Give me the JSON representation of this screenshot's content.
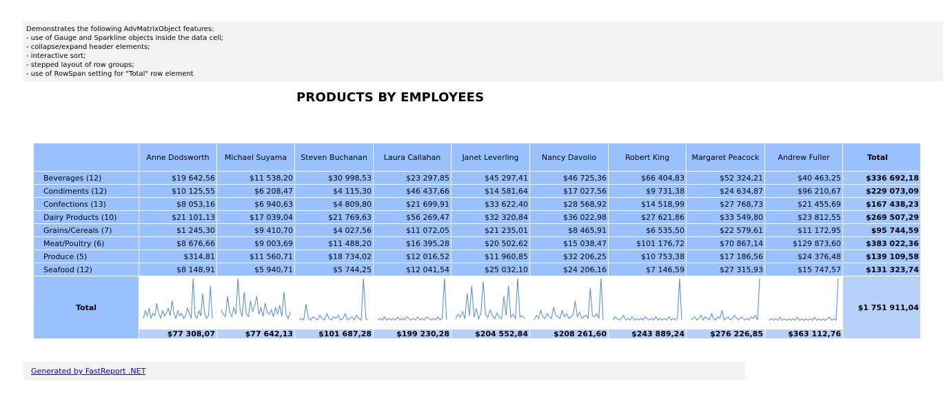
{
  "description": [
    "Demonstrates the following AdvMatrixObject features:",
    "- use of Gauge and Sparkline objects inside the data cell;",
    "- collapse/expand header elements;",
    "- interactive sort;",
    "- stepped layout of row groups;",
    "- use of RowSpan setting for \"Total\" row element"
  ],
  "title": "PRODUCTS BY EMPLOYEES",
  "matrix": {
    "employees": [
      "Anne Dodsworth",
      "Michael Suyama",
      "Steven Buchanan",
      "Laura Callahan",
      "Janet Leverling",
      "Nancy Davolio",
      "Robert King",
      "Margaret Peacock",
      "Andrew Fuller"
    ],
    "total_header": "Total",
    "rows": [
      {
        "label": "Beverages (12)",
        "values": [
          "$19 642,56",
          "$11 538,20",
          "$30 998,53",
          "$23 297,85",
          "$45 297,41",
          "$46 725,36",
          "$66 404,83",
          "$52 324,21",
          "$40 463,25"
        ],
        "total": "$336 692,18"
      },
      {
        "label": "Condiments (12)",
        "values": [
          "$10 125,55",
          "$6 208,47",
          "$4 115,30",
          "$46 437,66",
          "$14 581,64",
          "$17 027,56",
          "$9 731,38",
          "$24 634,87",
          "$96 210,67"
        ],
        "total": "$229 073,09"
      },
      {
        "label": "Confections (13)",
        "values": [
          "$8 053,16",
          "$6 940,63",
          "$4 809,80",
          "$21 699,91",
          "$33 622,40",
          "$28 568,92",
          "$14 518,99",
          "$27 768,73",
          "$21 455,69"
        ],
        "total": "$167 438,23"
      },
      {
        "label": "Dairy Products (10)",
        "values": [
          "$21 101,13",
          "$17 039,04",
          "$21 769,63",
          "$56 269,47",
          "$32 320,84",
          "$36 022,98",
          "$27 621,86",
          "$33 549,80",
          "$23 812,55"
        ],
        "total": "$269 507,29"
      },
      {
        "label": "Grains/Cereals (7)",
        "values": [
          "$1 245,30",
          "$9 410,70",
          "$4 027,56",
          "$11 072,05",
          "$21 235,01",
          "$8 465,91",
          "$6 535,50",
          "$22 579,61",
          "$11 172,95"
        ],
        "total": "$95 744,59"
      },
      {
        "label": "Meat/Poultry (6)",
        "values": [
          "$8 676,66",
          "$9 003,69",
          "$11 488,20",
          "$16 395,28",
          "$20 502,62",
          "$15 038,47",
          "$101 176,72",
          "$70 867,14",
          "$129 873,60"
        ],
        "total": "$383 022,36"
      },
      {
        "label": "Produce (5)",
        "values": [
          "$314,81",
          "$11 560,71",
          "$18 734,02",
          "$12 016,52",
          "$11 960,85",
          "$32 206,25",
          "$10 753,38",
          "$17 186,56",
          "$24 376,48"
        ],
        "total": "$139 109,58"
      },
      {
        "label": "Seafood (12)",
        "values": [
          "$8 148,91",
          "$5 940,71",
          "$5 744,25",
          "$12 041,54",
          "$25 032,10",
          "$24 206,16",
          "$7 146,59",
          "$27 315,93",
          "$15 747,57"
        ],
        "total": "$131 323,74"
      }
    ],
    "total_label": "Total",
    "column_totals": [
      "$77 308,07",
      "$77 642,13",
      "$101 687,28",
      "$199 230,28",
      "$204 552,84",
      "$208 261,60",
      "$243 889,24",
      "$276 226,85",
      "$363 112,76"
    ],
    "grand_total": "$1 751 911,04",
    "sparkline_color": "#4a86d8",
    "sparklines": [
      [
        2,
        5,
        3,
        6,
        2,
        4,
        3,
        8,
        4,
        2,
        5,
        3,
        4,
        6,
        3,
        9,
        4,
        2,
        5,
        3,
        4,
        2,
        3,
        6,
        4,
        2,
        18,
        3,
        2,
        5,
        3,
        12,
        4,
        2,
        3,
        15,
        2
      ],
      [
        6,
        4,
        3,
        12,
        5,
        3,
        7,
        4,
        20,
        6,
        3,
        14,
        4,
        3,
        10,
        5,
        8,
        12,
        4,
        7,
        3,
        9,
        5,
        4,
        6,
        3,
        7,
        4,
        8,
        3,
        14,
        4,
        2,
        5
      ],
      [
        2,
        3,
        2,
        12,
        3,
        2,
        4,
        3,
        2,
        5,
        3,
        2,
        6,
        3,
        2,
        4,
        3,
        5,
        2,
        3,
        6,
        2,
        3,
        4,
        2,
        5,
        3,
        2,
        28,
        3,
        2
      ],
      [
        2,
        3,
        2,
        4,
        2,
        3,
        2,
        3,
        2,
        4,
        2,
        3,
        2,
        4,
        3,
        2,
        3,
        2,
        4,
        2,
        3,
        2,
        4,
        3,
        2,
        3,
        2,
        4,
        2,
        3,
        28,
        2
      ],
      [
        3,
        6,
        4,
        8,
        3,
        20,
        5,
        25,
        4,
        10,
        3,
        7,
        28,
        6,
        4,
        9,
        5,
        3,
        7,
        4,
        3,
        18,
        5,
        25,
        4,
        6,
        3,
        30,
        4,
        5,
        3
      ],
      [
        2,
        5,
        3,
        8,
        4,
        3,
        6,
        4,
        3,
        10,
        5,
        4,
        3,
        8,
        4,
        6,
        3,
        4,
        5,
        14,
        4,
        7,
        3,
        4,
        5,
        3,
        22,
        5,
        4,
        6,
        3,
        28,
        2
      ],
      [
        2,
        4,
        3,
        2,
        3,
        5,
        2,
        3,
        2,
        4,
        2,
        3,
        2,
        3,
        2,
        4,
        3,
        2,
        3,
        2,
        4,
        2,
        3,
        2,
        3,
        2,
        4,
        2,
        3,
        2,
        3,
        28,
        2
      ],
      [
        2,
        3,
        4,
        2,
        3,
        5,
        2,
        4,
        3,
        2,
        6,
        3,
        2,
        4,
        3,
        8,
        2,
        3,
        4,
        2,
        3,
        5,
        3,
        2,
        4,
        3,
        2,
        3,
        2,
        4,
        3,
        5,
        2,
        28
      ],
      [
        2,
        3,
        2,
        3,
        2,
        4,
        2,
        3,
        2,
        3,
        2,
        3,
        2,
        4,
        2,
        3,
        2,
        3,
        2,
        3,
        2,
        4,
        2,
        3,
        2,
        3,
        2,
        3,
        4,
        2,
        3,
        2,
        30
      ]
    ]
  },
  "footer": {
    "link_text": "Generated by FastReport .NET"
  }
}
